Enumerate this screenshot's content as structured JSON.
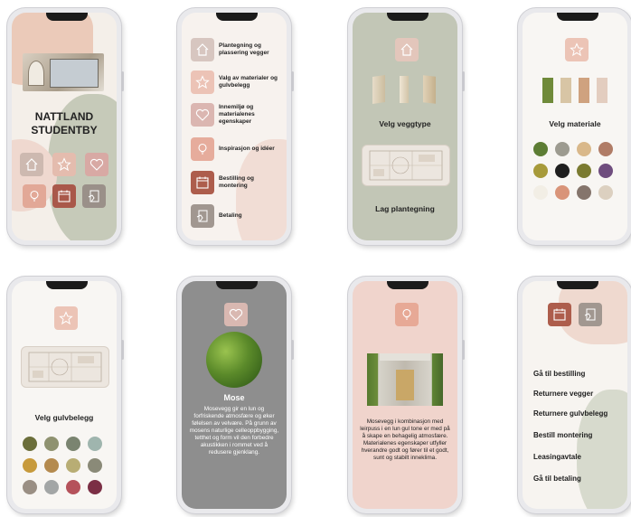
{
  "screen1": {
    "title": "NATTLAND\nSTUDENTBY"
  },
  "screen2": {
    "items": [
      "Plantegning og plassering vegger",
      "Valg av materialer og gulvbelegg",
      "Innemiljø og materialenes egenskaper",
      "Inspirasjon og idéer",
      "Bestilling og montering",
      "Betaling"
    ]
  },
  "screen3": {
    "wall_type_label": "Velg veggtype",
    "floor_plan_label": "Lag plantegning"
  },
  "screen4": {
    "material_label": "Velg materiale"
  },
  "screen5": {
    "floor_label": "Velg gulvbelegg"
  },
  "screen6": {
    "heading": "Mose",
    "text": "Mosevegg gir en lun og forfriskende atmosfære og øker følelsen av velvære. På grunn av mosens naturlige celleoppbygging, tetthet og form vil den forbedre akustikken i rommet ved å redusere gjenklang."
  },
  "screen7": {
    "text": "Mosevegg i kombinasjon med leirpuss i en lun gul tone er med på å skape en behagelig atmosfære. Materialenes egenskaper utfyller hverandre godt og fører til et godt, sunt og stabilt inneklima."
  },
  "screen8": {
    "items": [
      "Gå til bestilling",
      "Returnere vegger",
      "Returnere gulvbelegg",
      "Bestill montering",
      "Leasingavtale",
      "Gå til betaling"
    ]
  },
  "colors": {
    "peach": "#e9b9a6",
    "rose": "#d9a0a0",
    "terracotta": "#b5644f",
    "sage": "#c4c8b8",
    "taupe": "#c9beb5",
    "gray_screen": "#8f8f8f",
    "pink_screen": "#efd3cb"
  },
  "icons": [
    "house-icon",
    "star-icon",
    "heart-icon",
    "lightbulb-icon",
    "calendar-icon",
    "payment-icon"
  ]
}
